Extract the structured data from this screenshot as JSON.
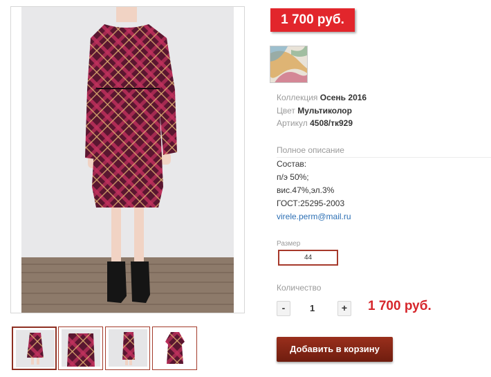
{
  "price_badge": "1 700 руб.",
  "properties": [
    {
      "key": "Коллекция",
      "value": "Осень 2016"
    },
    {
      "key": "Цвет",
      "value": "Мультиколор"
    },
    {
      "key": "Артикул",
      "value": "4508/тк929"
    }
  ],
  "description": {
    "title": "Полное описание",
    "lines": [
      "Состав:",
      "п/э 50%;",
      "вис.47%,эл.3%",
      "ГОСТ:25295-2003"
    ],
    "email": "virele.perm@mail.ru"
  },
  "size": {
    "label": "Размер",
    "selected": "44"
  },
  "quantity": {
    "label": "Количество",
    "minus": "-",
    "plus": "+",
    "value": "1"
  },
  "total_price": "1 700 руб.",
  "add_to_cart": "Добавить в корзину",
  "colors": {
    "price_red": "#e2262c",
    "button_brown": "#8a2a18",
    "accent_border": "#a6382a"
  }
}
